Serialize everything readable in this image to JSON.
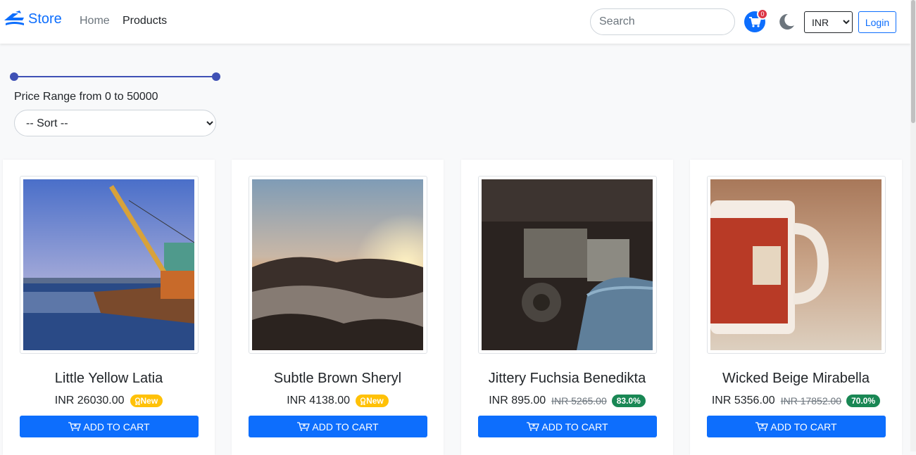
{
  "navbar": {
    "brand": "Store",
    "links": [
      "Home",
      "Products"
    ],
    "search_placeholder": "Search",
    "cart_count": "0",
    "currency": {
      "selected": "INR",
      "options": [
        "INR"
      ]
    },
    "login_label": "Login"
  },
  "filters": {
    "price_range_text": "Price Range from 0 to 50000",
    "price_min": 0,
    "price_max": 50000,
    "sort_placeholder": "-- Sort --"
  },
  "products": [
    {
      "name": "Little Yellow Latia",
      "price": "INR 26030.00",
      "old_price": "",
      "badge": "New",
      "badge_type": "new",
      "add_label": "ADD TO CART"
    },
    {
      "name": "Subtle Brown Sheryl",
      "price": "INR 4138.00",
      "old_price": "",
      "badge": "New",
      "badge_type": "new",
      "add_label": "ADD TO CART"
    },
    {
      "name": "Jittery Fuchsia Benedikta",
      "price": "INR 895.00",
      "old_price": "INR 5265.00",
      "badge": "83.0%",
      "badge_type": "discount",
      "add_label": "ADD TO CART"
    },
    {
      "name": "Wicked Beige Mirabella",
      "price": "INR 5356.00",
      "old_price": "INR 17852.00",
      "badge": "70.0%",
      "badge_type": "discount",
      "add_label": "ADD TO CART"
    }
  ],
  "colors": {
    "primary": "#0d6efd",
    "slider": "#3f51b5",
    "new_badge": "#ffc107",
    "discount_badge": "#198754",
    "cart_badge": "#dc3545"
  }
}
